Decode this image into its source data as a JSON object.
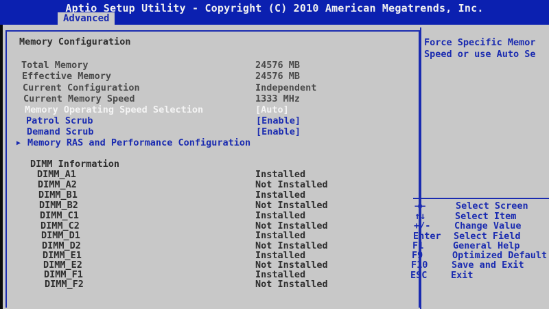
{
  "header": {
    "title": "Aptio Setup Utility - Copyright (C) 2010 American Megatrends, Inc.",
    "active_tab": "Advanced"
  },
  "main": {
    "section_title": "Memory Configuration",
    "info": [
      {
        "label": "Total Memory",
        "value": "24576 MB"
      },
      {
        "label": "Effective Memory",
        "value": "24576 MB"
      },
      {
        "label": "Current Configuration",
        "value": "Independent"
      },
      {
        "label": "Current Memory Speed",
        "value": "1333 MHz"
      }
    ],
    "options": [
      {
        "label": "Memory Operating Speed Selection",
        "value": "[Auto]"
      },
      {
        "label": "Patrol Scrub",
        "value": "[Enable]"
      },
      {
        "label": "Demand Scrub",
        "value": "[Enable]"
      }
    ],
    "submenu": {
      "arrow": "▶",
      "label": "Memory RAS and Performance Configuration"
    },
    "dimm_title": "DIMM Information",
    "dimms": [
      {
        "slot": "DIMM_A1",
        "status": "Installed"
      },
      {
        "slot": "DIMM_A2",
        "status": "Not Installed"
      },
      {
        "slot": "DIMM_B1",
        "status": "Installed"
      },
      {
        "slot": "DIMM_B2",
        "status": "Not Installed"
      },
      {
        "slot": "DIMM_C1",
        "status": "Installed"
      },
      {
        "slot": "DIMM_C2",
        "status": "Not Installed"
      },
      {
        "slot": "DIMM_D1",
        "status": "Installed"
      },
      {
        "slot": "DIMM_D2",
        "status": "Not Installed"
      },
      {
        "slot": "DIMM_E1",
        "status": "Installed"
      },
      {
        "slot": "DIMM_E2",
        "status": "Not Installed"
      },
      {
        "slot": "DIMM_F1",
        "status": "Installed"
      },
      {
        "slot": "DIMM_F2",
        "status": "Not Installed"
      }
    ]
  },
  "help": {
    "line1": "Force Specific Memor",
    "line2": "Speed or use Auto Se"
  },
  "keys": [
    {
      "key": "→←",
      "desc": "Select Screen"
    },
    {
      "key": "↑↓",
      "desc": "Select Item"
    },
    {
      "key": "+/-",
      "desc": "Change Value"
    },
    {
      "key": "Enter",
      "desc": "Select Field"
    },
    {
      "key": "F1",
      "desc": "General Help"
    },
    {
      "key": "F9",
      "desc": "Optimized Default"
    },
    {
      "key": "F10",
      "desc": "Save and Exit"
    },
    {
      "key": "ESC",
      "desc": "Exit"
    }
  ],
  "colors": {
    "bios_blue": "#1a2bb0",
    "panel_gray": "#c8c8c8",
    "header_blue": "#0b20b0",
    "highlight_white": "#f4f4f4"
  }
}
